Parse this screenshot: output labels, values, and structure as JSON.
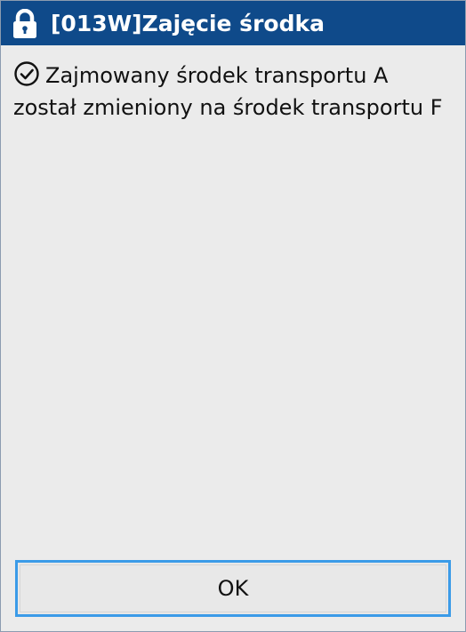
{
  "dialog": {
    "title": "[013W]Zajęcie środka",
    "title_icon": "lock-icon",
    "message_icon": "check-circle-icon",
    "message": "Zajmowany środek transportu A został zmieniony na środek transportu F",
    "ok_label": "OK",
    "colors": {
      "title_bar": "#0f4a8a",
      "background": "#ebebeb",
      "button_border": "#3b9be8"
    }
  }
}
